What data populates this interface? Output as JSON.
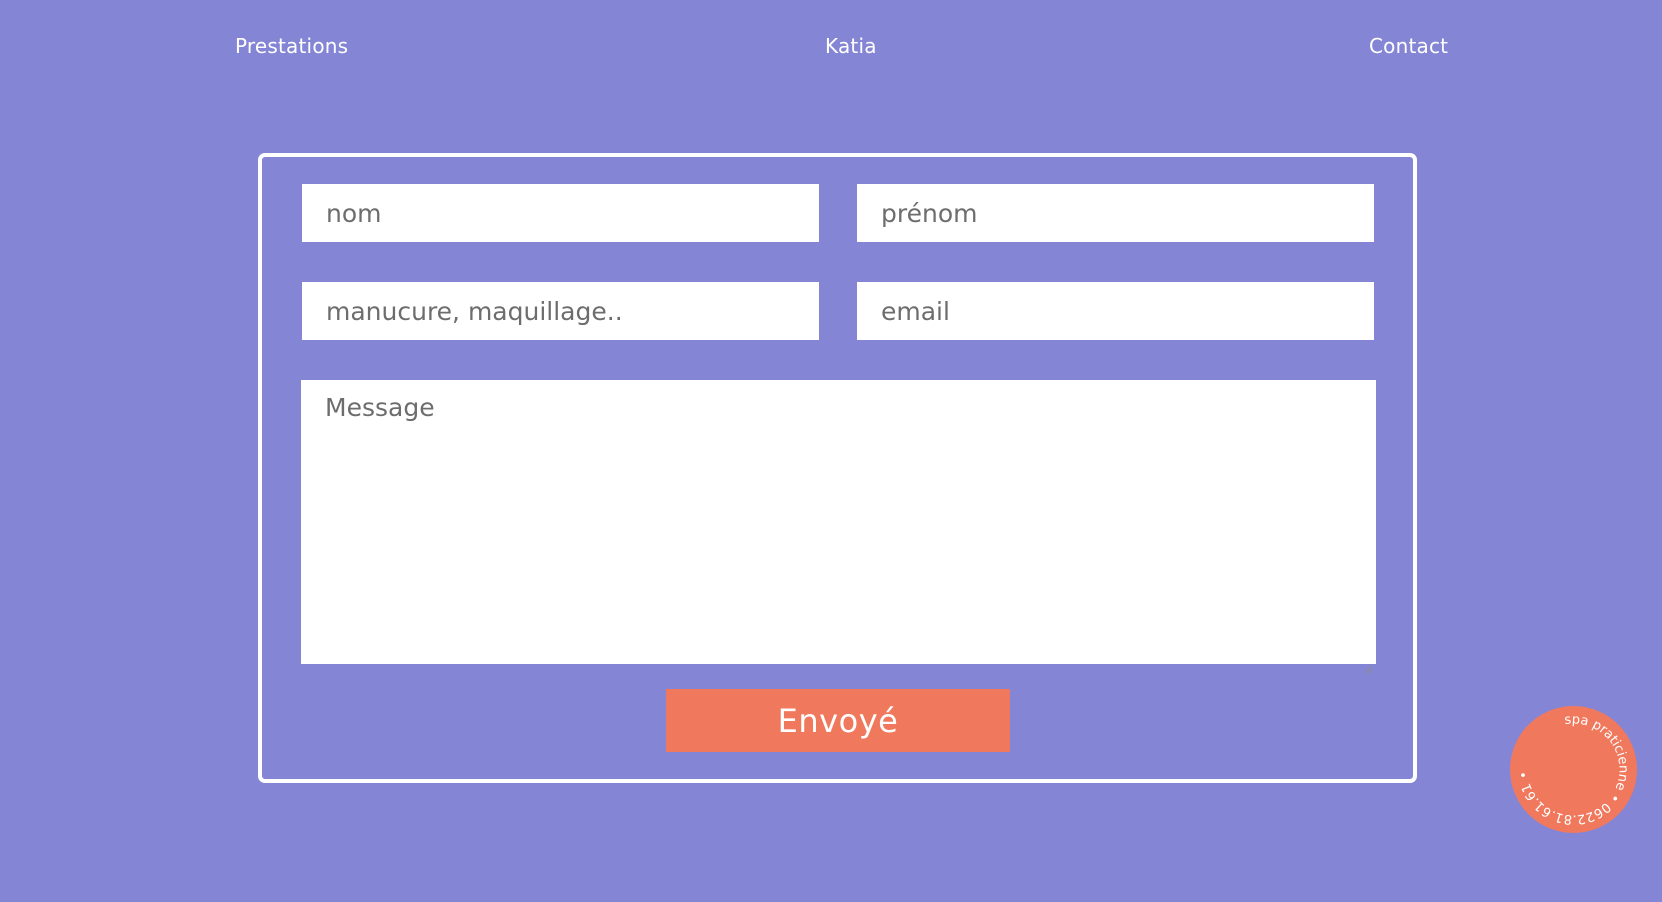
{
  "nav": {
    "left": "Prestations",
    "center": "Katia",
    "right": "Contact"
  },
  "form": {
    "nom_placeholder": "nom",
    "prenom_placeholder": "prénom",
    "service_placeholder": "manucure, maquillage..",
    "email_placeholder": "email",
    "message_placeholder": "Message",
    "submit_label": "Envoyé"
  },
  "badge": {
    "text": "spa praticienne • 0622.81.61.61 •"
  },
  "colors": {
    "background": "#8585d6",
    "accent": "#f0795d",
    "field": "#ffffff"
  },
  "icons": {
    "resize": "resize-grip-icon"
  }
}
